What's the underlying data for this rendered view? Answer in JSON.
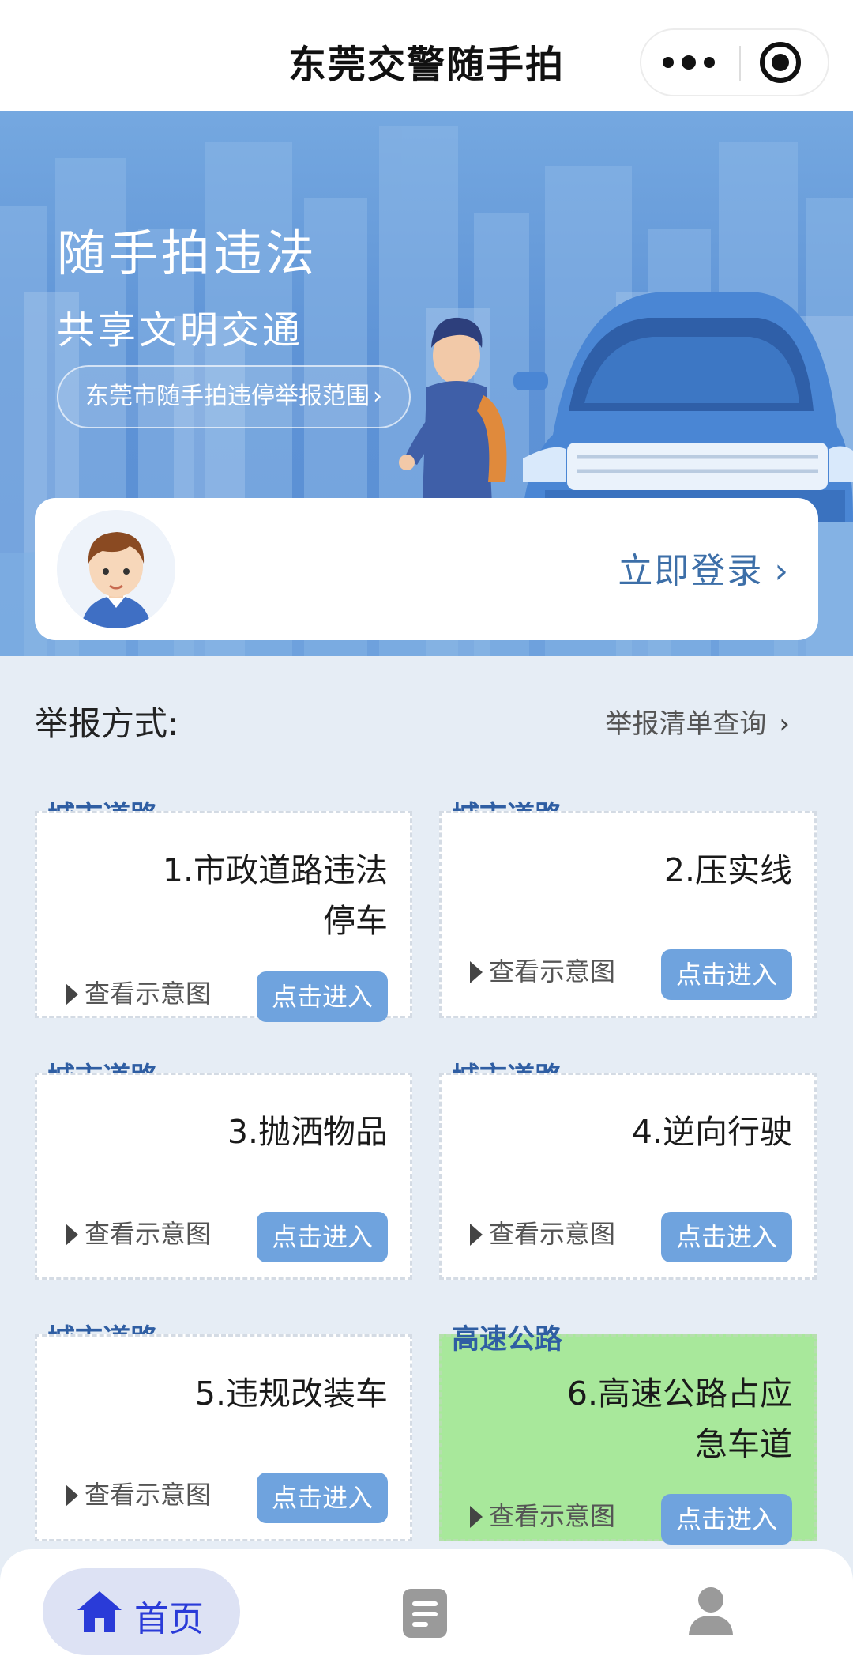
{
  "navbar": {
    "title": "东莞交警随手拍"
  },
  "hero": {
    "title": "随手拍违法",
    "subtitle": "共享文明交通",
    "scope_link": "东莞市随手拍违停举报范围",
    "scope_chevron": "›"
  },
  "login": {
    "label": "立即登录",
    "chevron": "›"
  },
  "report_section": {
    "label": "举报方式:",
    "query_link": "举报清单查询",
    "query_chevron": "›"
  },
  "cards": [
    {
      "tag": "城市道路",
      "title": "1.市政道路违法停车",
      "diagram_link": "查看示意图",
      "enter_label": "点击进入"
    },
    {
      "tag": "城市道路",
      "title": "2.压实线",
      "diagram_link": "查看示意图",
      "enter_label": "点击进入"
    },
    {
      "tag": "城市道路",
      "title": "3.抛洒物品",
      "diagram_link": "查看示意图",
      "enter_label": "点击进入"
    },
    {
      "tag": "城市道路",
      "title": "4.逆向行驶",
      "diagram_link": "查看示意图",
      "enter_label": "点击进入"
    },
    {
      "tag": "城市道路",
      "title": "5.违规改装车",
      "diagram_link": "查看示意图",
      "enter_label": "点击进入"
    },
    {
      "tag": "高速公路",
      "title": "6.高速公路占应急车道",
      "diagram_link": "查看示意图",
      "enter_label": "点击进入"
    }
  ],
  "tabbar": {
    "home_label": "首页",
    "icons": [
      "home-icon",
      "list-icon",
      "user-icon"
    ],
    "active_color": "#2a3bd8"
  },
  "colors": {
    "accent": "#6fa3de",
    "tag": "#2f5ea3",
    "highway_card": "#a8e89b",
    "hero": "#5e93d6"
  }
}
